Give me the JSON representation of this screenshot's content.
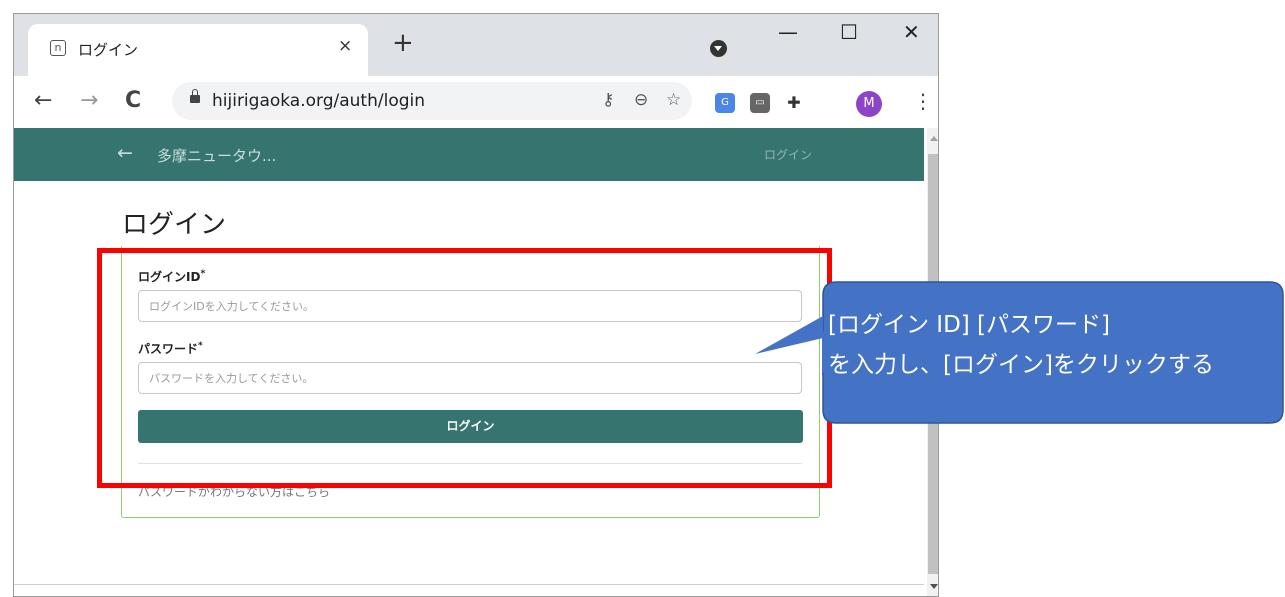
{
  "browser": {
    "tab": {
      "title": "ログイン",
      "favicon": "n",
      "close": "×"
    },
    "new_tab": "+",
    "window_controls": {
      "minimize": "—",
      "maximize": "☐",
      "close": "✕"
    },
    "nav": {
      "back": "←",
      "forward": "→",
      "reload": "C"
    },
    "url": "hijirigaoka.org/auth/login",
    "omnibox_icons": [
      "key-icon",
      "zoom-out-icon",
      "star-icon"
    ],
    "extensions": [
      "google-translate-icon",
      "line-icon",
      "puzzle-icon"
    ],
    "avatar": "M",
    "menu": "⋮"
  },
  "site": {
    "back_label": "←",
    "name": "多摩ニュータウ...",
    "header_login": "ログイン"
  },
  "page": {
    "title": "ログイン",
    "login_id_label": "ログインID",
    "login_id_placeholder": "ログインIDを入力してください。",
    "password_label": "パスワード",
    "password_placeholder": "パスワードを入力してください。",
    "required_mark": "*",
    "login_button": "ログイン",
    "forgot_password": "パスワードがわからない方はこちら"
  },
  "annotation": {
    "callout_line1": "[ログイン ID] [パスワード]",
    "callout_line2": "を入力し、[ログイン]をクリックする",
    "highlight_color": "#ff0000",
    "callout_color": "#4472c4"
  },
  "colors": {
    "header": "#36746f",
    "button": "#36746f",
    "card_border": "#8ed06b"
  }
}
